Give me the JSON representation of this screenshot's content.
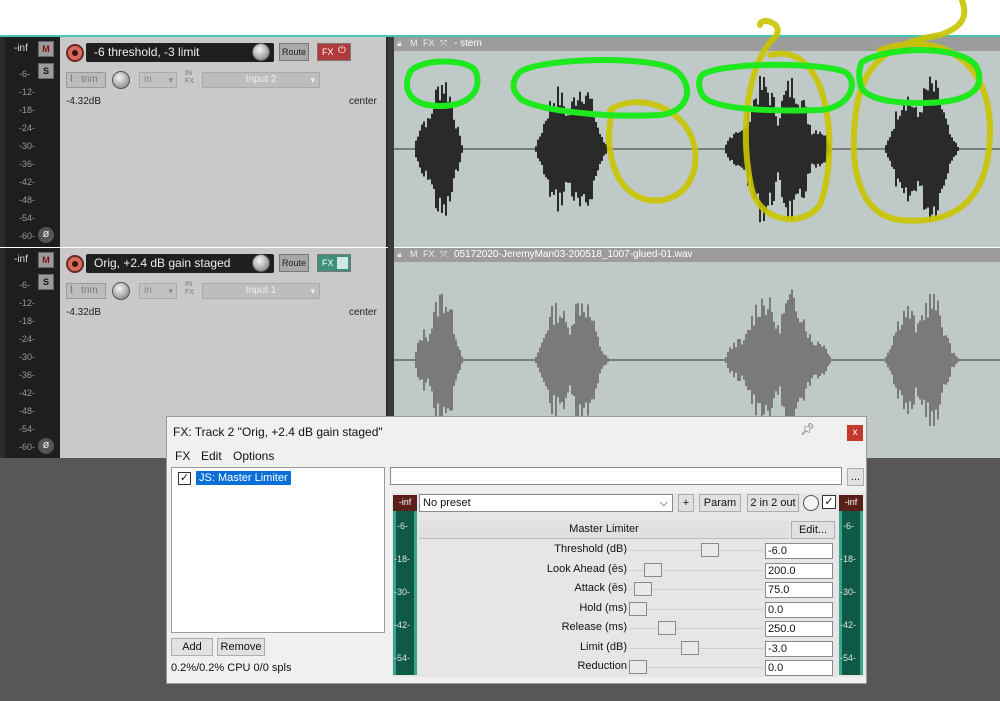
{
  "tracks": [
    {
      "meter_inf": "-inf",
      "mute_label": "M",
      "solo_label": "S",
      "db_ticks": [
        "-6-",
        "-12-",
        "-18-",
        "-24-",
        "-30-",
        "-36-",
        "-42-",
        "-48-",
        "-54-",
        "-60-"
      ],
      "name": "-6 threshold, -3 limit",
      "route_label": "Route",
      "fx_label": "FX",
      "trim_label": "trim",
      "in_label": "in",
      "in_fx_label": "IN FX",
      "input_label": "Input 2",
      "volume_readout": "-4.32dB",
      "pan_readout": "center"
    },
    {
      "meter_inf": "-inf",
      "mute_label": "M",
      "solo_label": "S",
      "db_ticks": [
        "-6-",
        "-12-",
        "-18-",
        "-24-",
        "-30-",
        "-36-",
        "-42-",
        "-48-",
        "-54-",
        "-60-"
      ],
      "name": "Orig, +2.4 dB gain staged",
      "route_label": "Route",
      "fx_label": "FX",
      "trim_label": "trim",
      "in_label": "in",
      "in_fx_label": "IN FX",
      "input_label": "Input 1",
      "volume_readout": "-4.32dB",
      "pan_readout": "center"
    }
  ],
  "items": [
    {
      "header_label": "- stem",
      "waveform_color": "#2a2a2a"
    },
    {
      "header_label": "05172020-JeremyMan03-200518_1007-glued-01.wav",
      "waveform_color": "#7a7a7a"
    }
  ],
  "fx_window": {
    "title": "FX: Track 2 \"Orig, +2.4 dB gain staged\"",
    "close_label": "x",
    "menu": [
      "FX",
      "Edit",
      "Options"
    ],
    "chain": [
      {
        "label": "JS: Master Limiter",
        "enabled": true
      }
    ],
    "add_label": "Add",
    "remove_label": "Remove",
    "cpu_status": "0.2%/0.2% CPU 0/0 spls",
    "browse_label": "...",
    "preset": "No preset",
    "plus_label": "+",
    "param_label": "Param",
    "io_label": "2 in 2 out",
    "plugin_name": "Master Limiter",
    "edit_label": "Edit...",
    "meter_inf": "-inf",
    "meter_ticks": [
      "-6-",
      "-18-",
      "-30-",
      "-42-",
      "-54-"
    ],
    "params": [
      {
        "label": "Threshold (dB)",
        "value": "-6.0",
        "level": 0.62
      },
      {
        "label": "Look Ahead (ēs)",
        "value": "200.0",
        "level": 0.13
      },
      {
        "label": "Attack (ēs)",
        "value": "75.0",
        "level": 0.04
      },
      {
        "label": "Hold (ms)",
        "value": "0.0",
        "level": 0.0
      },
      {
        "label": "Release (ms)",
        "value": "250.0",
        "level": 0.25
      },
      {
        "label": "Limit (dB)",
        "value": "-3.0",
        "level": 0.45
      },
      {
        "label": "Reduction",
        "value": "0.0",
        "level": 0.0
      }
    ]
  },
  "colors": {
    "accent_teal": "#45c4b0",
    "annotation_green": "#1ee81e",
    "annotation_yellow": "#c9c400"
  }
}
